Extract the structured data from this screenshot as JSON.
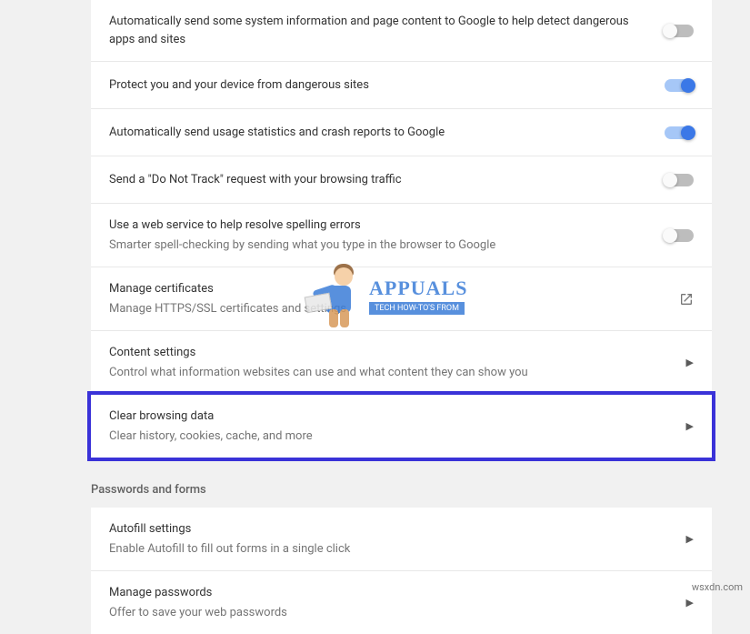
{
  "privacy": {
    "rows": [
      {
        "title": "Automatically send some system information and page content to Google to help detect dangerous apps and sites",
        "sub": "",
        "control": "toggle",
        "state": "off"
      },
      {
        "title": "Protect you and your device from dangerous sites",
        "sub": "",
        "control": "toggle",
        "state": "on"
      },
      {
        "title": "Automatically send usage statistics and crash reports to Google",
        "sub": "",
        "control": "toggle",
        "state": "on"
      },
      {
        "title": "Send a \"Do Not Track\" request with your browsing traffic",
        "sub": "",
        "control": "toggle",
        "state": "off"
      },
      {
        "title": "Use a web service to help resolve spelling errors",
        "sub": "Smarter spell-checking by sending what you type in the browser to Google",
        "control": "toggle",
        "state": "off"
      },
      {
        "title": "Manage certificates",
        "sub": "Manage HTTPS/SSL certificates and settings",
        "control": "external"
      },
      {
        "title": "Content settings",
        "sub": "Control what information websites can use and what content they can show you",
        "control": "arrow"
      },
      {
        "title": "Clear browsing data",
        "sub": "Clear history, cookies, cache, and more",
        "control": "arrow",
        "highlight": true
      }
    ]
  },
  "sections": {
    "passwords_header": "Passwords and forms",
    "passwords_rows": [
      {
        "title": "Autofill settings",
        "sub": "Enable Autofill to fill out forms in a single click",
        "control": "arrow"
      },
      {
        "title": "Manage passwords",
        "sub": "Offer to save your web passwords",
        "control": "arrow"
      }
    ]
  },
  "logo": {
    "title": "APPUALS",
    "sub": "TECH HOW-TO'S FROM"
  },
  "watermark": "wsxdn.com"
}
